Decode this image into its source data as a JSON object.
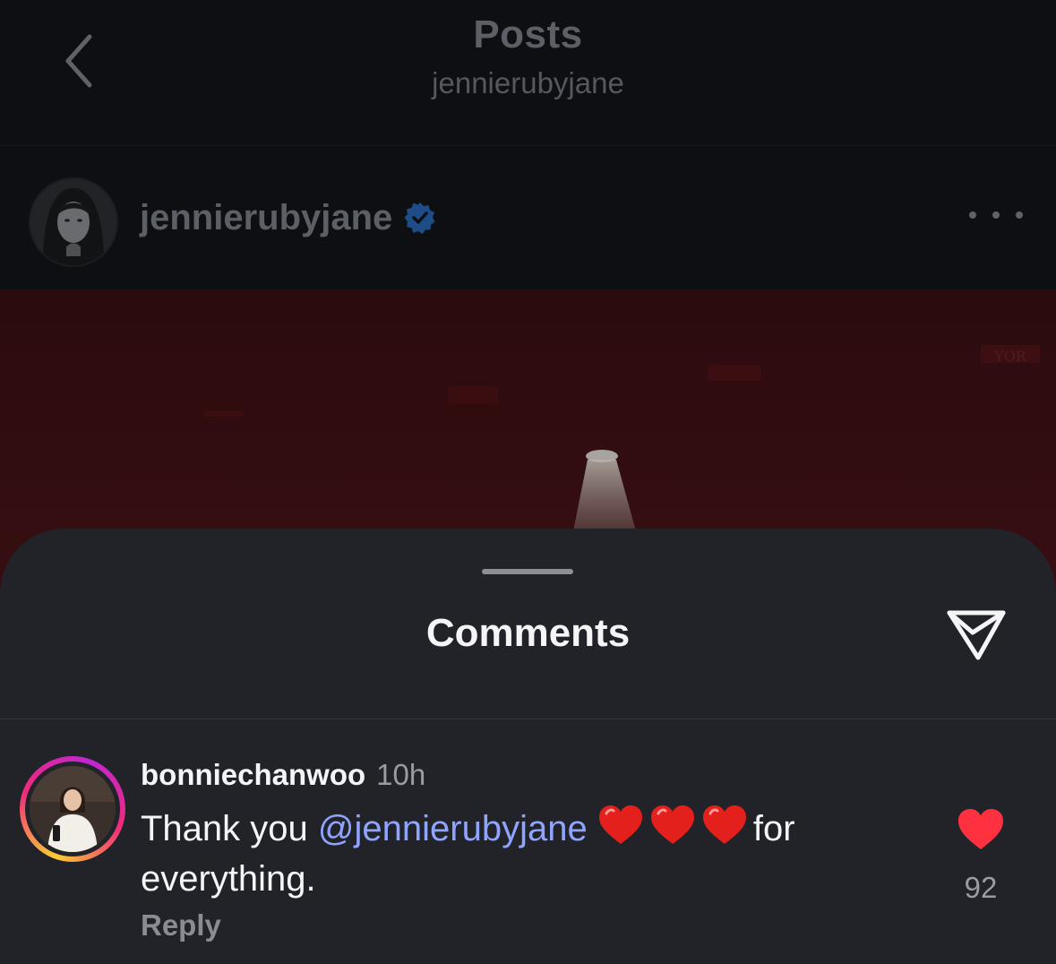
{
  "nav": {
    "title": "Posts",
    "subtitle": "jennierubyjane",
    "back_icon": "chevron-left-icon"
  },
  "post": {
    "username": "jennierubyjane",
    "verified": true,
    "verified_icon": "verified-badge-icon",
    "more_icon": "more-horizontal-icon",
    "image_dominant_color": "#2a0a0d",
    "image_text": "YOR"
  },
  "comments_sheet": {
    "title": "Comments",
    "share_icon": "send-icon",
    "comments": [
      {
        "username": "bonniechanwoo",
        "time": "10h",
        "text_before": "Thank you ",
        "mention": "@jennierubyjane",
        "emoji": "❤️❤️❤️",
        "text_after": "for everything.",
        "reply_label": "Reply",
        "like_icon": "heart-icon",
        "liked": true,
        "like_count": "92"
      }
    ]
  },
  "colors": {
    "background": "#0d0f12",
    "sheet": "#212329",
    "accent_heart": "#ff3040",
    "mention": "#8ea4ff",
    "verified": "#0095f6"
  }
}
